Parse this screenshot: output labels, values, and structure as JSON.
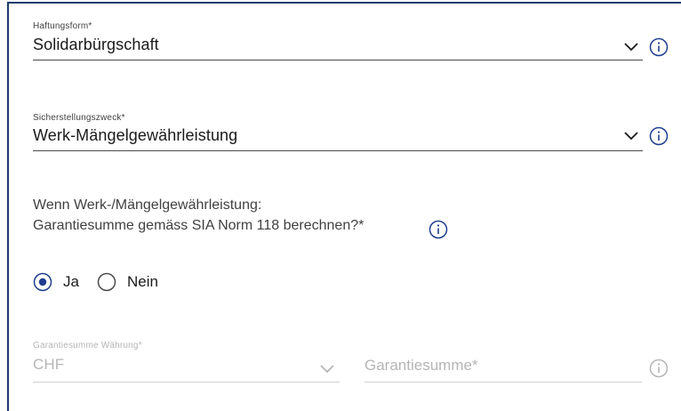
{
  "haftungsform": {
    "label": "Haftungsform*",
    "value": "Solidarbürgschaft"
  },
  "sicherstellungszweck": {
    "label": "Sicherstellungszweck*",
    "value": "Werk-Mängelgewährleistung"
  },
  "garantie_question": {
    "line1": "Wenn Werk-/Mängelgewährleistung:",
    "line2": "Garantiesumme gemäss SIA Norm 118 berechnen?*"
  },
  "radio": {
    "options": [
      {
        "label": "Ja",
        "selected": true
      },
      {
        "label": "Nein",
        "selected": false
      }
    ]
  },
  "garantiesumme_waehrung": {
    "label": "Garantiesumme Währung*",
    "value": "CHF"
  },
  "garantiesumme": {
    "placeholder": "Garantiesumme*"
  },
  "colors": {
    "accent": "#1f3d8f",
    "border": "#1f3d6a",
    "text": "#1a1a1a",
    "muted": "#b5b5b5"
  },
  "icons": [
    "chevron-down-icon",
    "info-icon",
    "radio-selected-icon",
    "radio-unselected-icon"
  ]
}
